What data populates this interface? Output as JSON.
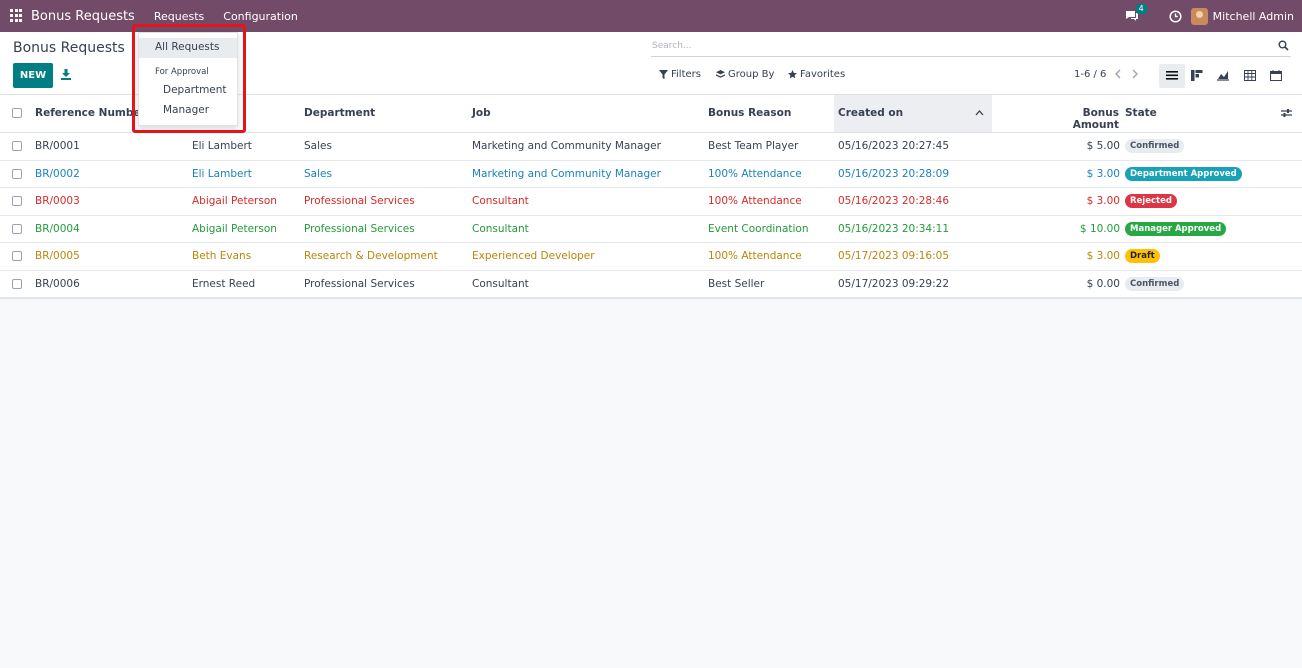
{
  "navbar": {
    "app_name": "Bonus Requests",
    "menus": [
      "Requests",
      "Configuration"
    ],
    "chat_count": "4",
    "user_name": "Mitchell Admin"
  },
  "control": {
    "title": "Bonus Requests",
    "new_label": "NEW",
    "search_placeholder": "Search...",
    "filters_label": "Filters",
    "groupby_label": "Group By",
    "favorites_label": "Favorites",
    "pager": "1-6 / 6"
  },
  "dropdown": {
    "all_requests": "All Requests",
    "section_header": "For Approval",
    "items": [
      "Department",
      "Manager"
    ]
  },
  "table": {
    "headers": {
      "reference": "Reference Number",
      "employee_tail": "e",
      "department": "Department",
      "job": "Job",
      "reason": "Bonus Reason",
      "created": "Created on",
      "amount": "Bonus Amount",
      "state": "State"
    },
    "rows": [
      {
        "ref": "BR/0001",
        "employee": "Eli Lambert",
        "department": "Sales",
        "job": "Marketing and Community Manager",
        "reason": "Best Team Player",
        "created": "05/16/2023 20:27:45",
        "amount": "$ 5.00",
        "state": "Confirmed",
        "color": "#374151",
        "badge_bg": "#e9ecef",
        "badge_fg": "#4b5563"
      },
      {
        "ref": "BR/0002",
        "employee": "Eli Lambert",
        "department": "Sales",
        "job": "Marketing and Community Manager",
        "reason": "100% Attendance",
        "created": "05/16/2023 20:28:09",
        "amount": "$ 3.00",
        "state": "Department Approved",
        "color": "#1a82b8",
        "badge_bg": "#17a2b8",
        "badge_fg": "#ffffff"
      },
      {
        "ref": "BR/0003",
        "employee": "Abigail Peterson",
        "department": "Professional Services",
        "job": "Consultant",
        "reason": "100% Attendance",
        "created": "05/16/2023 20:28:46",
        "amount": "$ 3.00",
        "state": "Rejected",
        "color": "#d42b2b",
        "badge_bg": "#dc3545",
        "badge_fg": "#ffffff"
      },
      {
        "ref": "BR/0004",
        "employee": "Abigail Peterson",
        "department": "Professional Services",
        "job": "Consultant",
        "reason": "Event Coordination",
        "created": "05/16/2023 20:34:11",
        "amount": "$ 10.00",
        "state": "Manager Approved",
        "color": "#239b3a",
        "badge_bg": "#28a745",
        "badge_fg": "#ffffff"
      },
      {
        "ref": "BR/0005",
        "employee": "Beth Evans",
        "department": "Research & Development",
        "job": "Experienced Developer",
        "reason": "100% Attendance",
        "created": "05/17/2023 09:16:05",
        "amount": "$ 3.00",
        "state": "Draft",
        "color": "#b8860b",
        "badge_bg": "#ffc107",
        "badge_fg": "#212529"
      },
      {
        "ref": "BR/0006",
        "employee": "Ernest Reed",
        "department": "Professional Services",
        "job": "Consultant",
        "reason": "Best Seller",
        "created": "05/17/2023 09:29:22",
        "amount": "$ 0.00",
        "state": "Confirmed",
        "color": "#374151",
        "badge_bg": "#e9ecef",
        "badge_fg": "#4b5563"
      }
    ]
  }
}
